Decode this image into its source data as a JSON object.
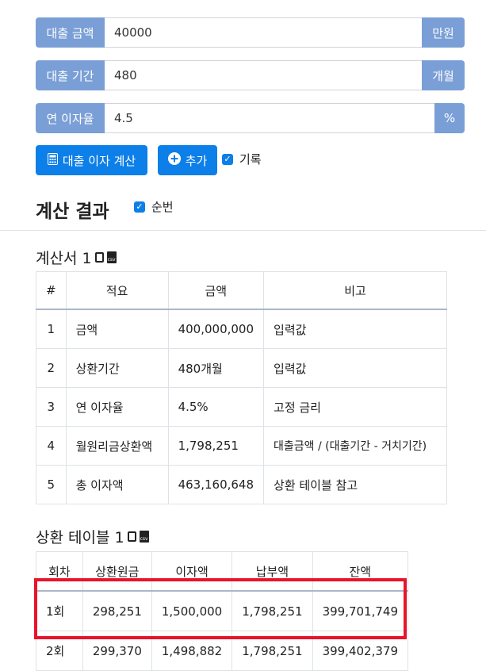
{
  "form": {
    "amount": {
      "label": "대출 금액",
      "value": "40000",
      "unit": "만원"
    },
    "period": {
      "label": "대출 기간",
      "value": "480",
      "unit": "개월"
    },
    "rate": {
      "label": "연 이자율",
      "value": "4.5",
      "unit": "%"
    }
  },
  "buttons": {
    "calculate": "대출 이자 계산",
    "add": "추가",
    "record_label": "기록"
  },
  "results": {
    "title": "계산 결과",
    "order_label": "순번"
  },
  "calc_sheet": {
    "title": "계산서 1",
    "headers": [
      "#",
      "적요",
      "금액",
      "비고"
    ],
    "rows": [
      [
        "1",
        "금액",
        "400,000,000",
        "입력값"
      ],
      [
        "2",
        "상환기간",
        "480개월",
        "입력값"
      ],
      [
        "3",
        "연 이자율",
        "4.5%",
        "고정 금리"
      ],
      [
        "4",
        "월원리금상환액",
        "1,798,251",
        "대출금액 / (대출기간 - 거치기간)"
      ],
      [
        "5",
        "총 이자액",
        "463,160,648",
        "상환 테이블 참고"
      ]
    ]
  },
  "repay_table": {
    "title": "상환 테이블 1",
    "headers": [
      "회차",
      "상환원금",
      "이자액",
      "납부액",
      "잔액"
    ],
    "rows": [
      [
        "1회",
        "298,251",
        "1,500,000",
        "1,798,251",
        "399,701,749"
      ],
      [
        "2회",
        "299,370",
        "1,498,882",
        "1,798,251",
        "399,402,379"
      ]
    ]
  },
  "colors": {
    "accent": "#0d7fe8",
    "addon": "#7a9fd6",
    "highlight": "#e8142c"
  }
}
